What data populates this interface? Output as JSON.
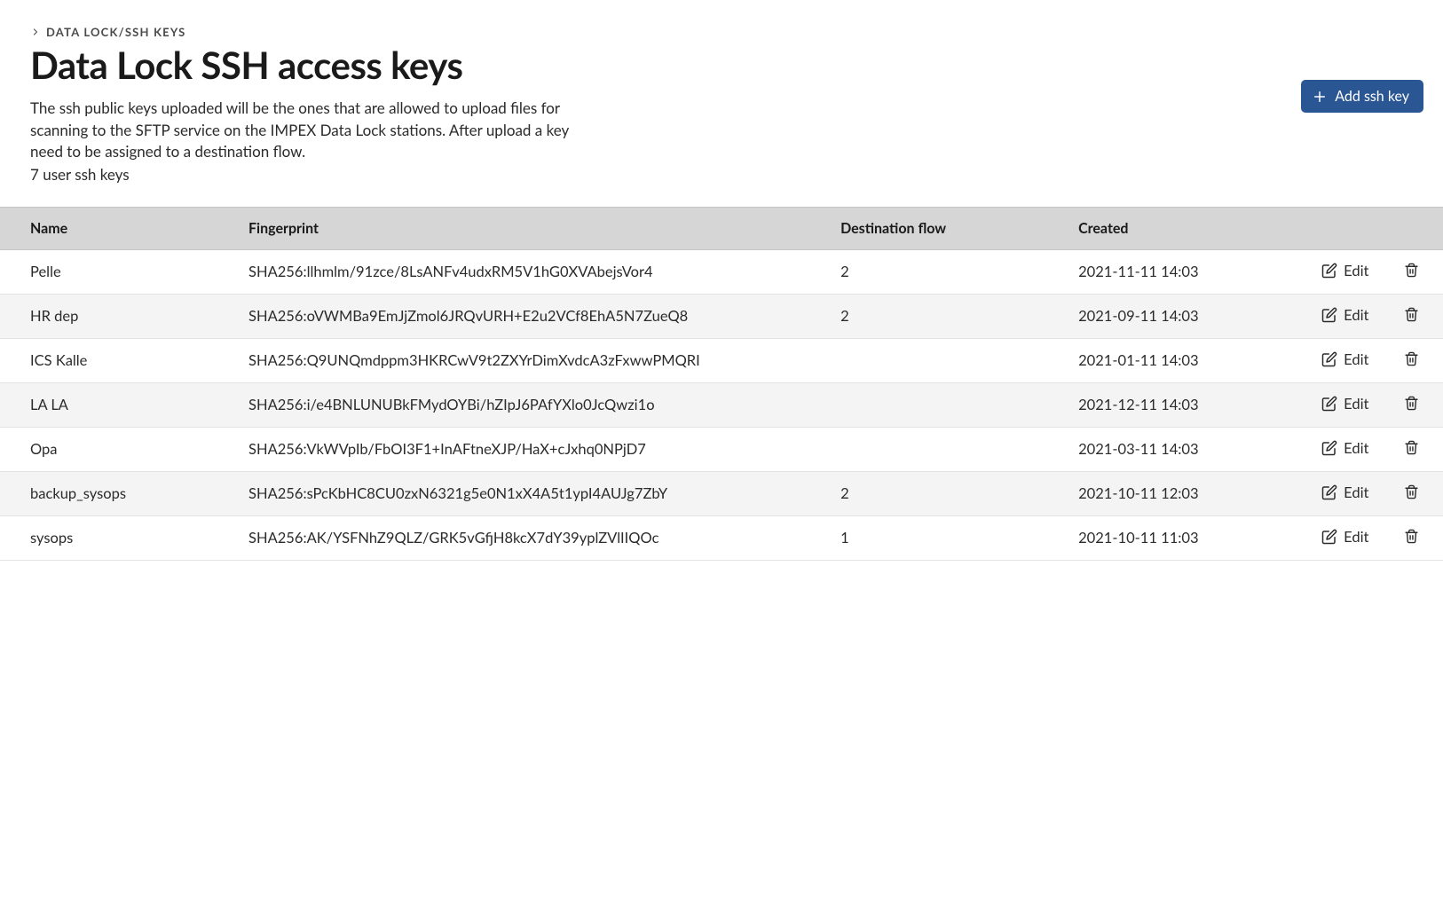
{
  "breadcrumb": {
    "text": "DATA LOCK/SSH KEYS"
  },
  "header": {
    "title": "Data Lock SSH access keys",
    "description": "The ssh public keys uploaded will be the ones that are allowed to upload files for scanning to the SFTP service on the IMPEX Data Lock stations. After upload a key need to be assigned to a destination flow.",
    "count_text": "7 user ssh keys",
    "add_button_label": "Add ssh key"
  },
  "table": {
    "columns": {
      "name": "Name",
      "fingerprint": "Fingerprint",
      "destination_flow": "Destination flow",
      "created": "Created"
    },
    "edit_label": "Edit",
    "rows": [
      {
        "name": "Pelle",
        "fingerprint": "SHA256:llhmlm/91zce/8LsANFv4udxRM5V1hG0XVAbejsVor4",
        "destination_flow": "2",
        "created": "2021-11-11 14:03"
      },
      {
        "name": "HR dep",
        "fingerprint": "SHA256:oVWMBa9EmJjZmol6JRQvURH+E2u2VCf8EhA5N7ZueQ8",
        "destination_flow": "2",
        "created": "2021-09-11 14:03"
      },
      {
        "name": "ICS Kalle",
        "fingerprint": "SHA256:Q9UNQmdppm3HKRCwV9t2ZXYrDimXvdcA3zFxwwPMQRI",
        "destination_flow": "",
        "created": "2021-01-11 14:03"
      },
      {
        "name": "LA LA",
        "fingerprint": "SHA256:i/e4BNLUNUBkFMydOYBi/hZIpJ6PAfYXlo0JcQwzi1o",
        "destination_flow": "",
        "created": "2021-12-11 14:03"
      },
      {
        "name": "Opa",
        "fingerprint": "SHA256:VkWVpIb/FbOI3F1+InAFtneXJP/HaX+cJxhq0NPjD7",
        "destination_flow": "",
        "created": "2021-03-11 14:03"
      },
      {
        "name": "backup_sysops",
        "fingerprint": "SHA256:sPcKbHC8CU0zxN6321g5e0N1xX4A5t1ypI4AUJg7ZbY",
        "destination_flow": "2",
        "created": "2021-10-11 12:03"
      },
      {
        "name": "sysops",
        "fingerprint": "SHA256:AK/YSFNhZ9QLZ/GRK5vGfjH8kcX7dY39yplZVlIIQOc",
        "destination_flow": "1",
        "created": "2021-10-11 11:03"
      }
    ]
  }
}
